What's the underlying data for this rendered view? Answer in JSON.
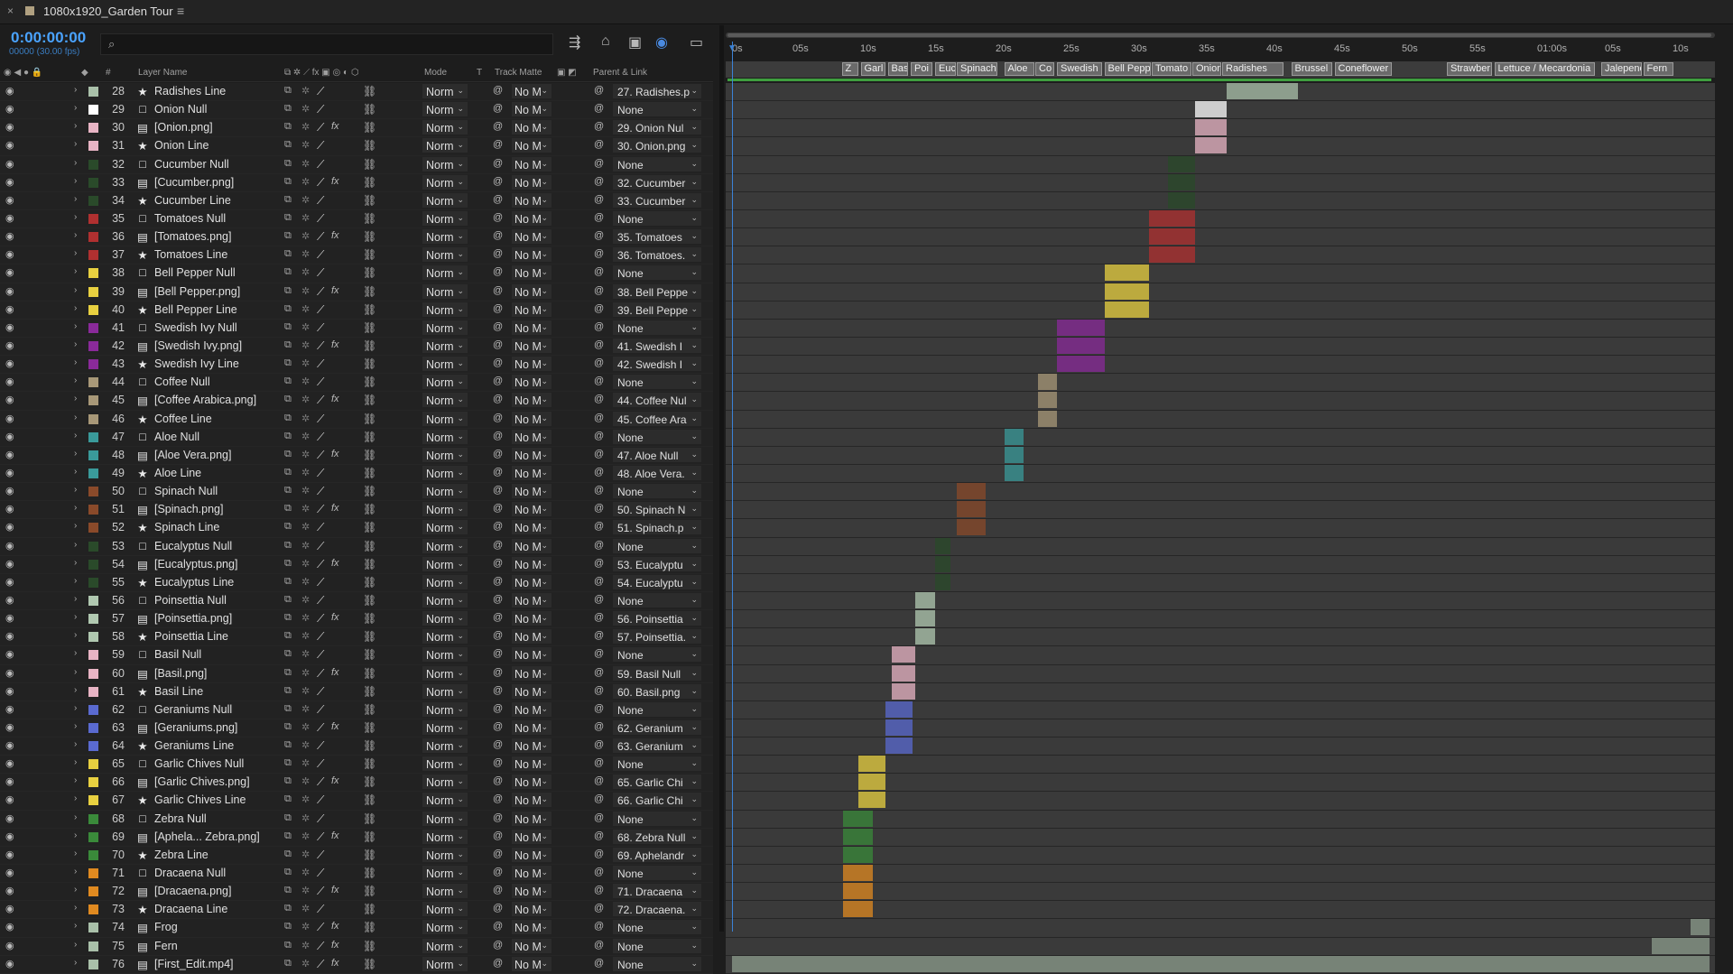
{
  "tab": {
    "close": "×",
    "title": "1080x1920_Garden Tour",
    "menu": "≡"
  },
  "timecode": "0:00:00:00",
  "fps": "00000 (30.00 fps)",
  "search": {
    "placeholder": ""
  },
  "headers": {
    "name": "Layer Name",
    "hash": "#",
    "mode": "Mode",
    "t": "T",
    "matte": "Track Matte",
    "parent": "Parent & Link"
  },
  "ruler_ticks": [
    "0s",
    "05s",
    "10s",
    "15s",
    "20s",
    "25s",
    "30s",
    "35s",
    "40s",
    "45s",
    "50s",
    "55s",
    "01:00s",
    "05s",
    "10s"
  ],
  "markers": [
    "Z",
    "Garl",
    "Basi",
    "Poi",
    "Euc",
    "Spinach",
    "Aloe",
    "Co",
    "Swedish",
    "Bell Pepp",
    "Tomato",
    "Onion",
    "Radishes",
    "Brussel",
    "Coneflower",
    "Strawber",
    "Lettuce / Mecardonia",
    "Jalepeno",
    "Fern"
  ],
  "layers": [
    {
      "num": "28",
      "name": "Radishes Line",
      "src": "★",
      "color": "#a9c0a9",
      "mode": "Norm",
      "matte": "No M",
      "parent": "27. Radishes.p",
      "start": 36.5,
      "end": 41.8
    },
    {
      "num": "29",
      "name": "Onion Null",
      "src": "□",
      "color": "#ffffff",
      "mode": "Norm",
      "matte": "No M",
      "parent": "None",
      "start": 34.2,
      "end": 36.5
    },
    {
      "num": "30",
      "name": "[Onion.png]",
      "src": "▤",
      "color": "#e8b4c4",
      "mode": "Norm",
      "matte": "No M",
      "parent": "29. Onion Nul",
      "start": 34.2,
      "end": 36.5
    },
    {
      "num": "31",
      "name": "Onion Line",
      "src": "★",
      "color": "#e8b4c4",
      "mode": "Norm",
      "matte": "No M",
      "parent": "30. Onion.png",
      "start": 34.2,
      "end": 36.5
    },
    {
      "num": "32",
      "name": "Cucumber Null",
      "src": "□",
      "color": "#2a4a2a",
      "mode": "Norm",
      "matte": "No M",
      "parent": "None",
      "start": 32.2,
      "end": 34.2
    },
    {
      "num": "33",
      "name": "[Cucumber.png]",
      "src": "▤",
      "color": "#2a4a2a",
      "mode": "Norm",
      "matte": "No M",
      "parent": "32. Cucumber",
      "start": 32.2,
      "end": 34.2
    },
    {
      "num": "34",
      "name": "Cucumber Line",
      "src": "★",
      "color": "#2a4a2a",
      "mode": "Norm",
      "matte": "No M",
      "parent": "33. Cucumber",
      "start": 32.2,
      "end": 34.2
    },
    {
      "num": "35",
      "name": "Tomatoes Null",
      "src": "□",
      "color": "#b03030",
      "mode": "Norm",
      "matte": "No M",
      "parent": "None",
      "start": 30.8,
      "end": 34.2
    },
    {
      "num": "36",
      "name": "[Tomatoes.png]",
      "src": "▤",
      "color": "#b03030",
      "mode": "Norm",
      "matte": "No M",
      "parent": "35. Tomatoes",
      "start": 30.8,
      "end": 34.2
    },
    {
      "num": "37",
      "name": "Tomatoes Line",
      "src": "★",
      "color": "#b03030",
      "mode": "Norm",
      "matte": "No M",
      "parent": "36. Tomatoes.",
      "start": 30.8,
      "end": 34.2
    },
    {
      "num": "38",
      "name": "Bell Pepper Null",
      "src": "□",
      "color": "#e8d040",
      "mode": "Norm",
      "matte": "No M",
      "parent": "None",
      "start": 27.5,
      "end": 30.8
    },
    {
      "num": "39",
      "name": "[Bell Pepper.png]",
      "src": "▤",
      "color": "#e8d040",
      "mode": "Norm",
      "matte": "No M",
      "parent": "38. Bell Peppe",
      "start": 27.5,
      "end": 30.8
    },
    {
      "num": "40",
      "name": "Bell Pepper Line",
      "src": "★",
      "color": "#e8d040",
      "mode": "Norm",
      "matte": "No M",
      "parent": "39. Bell Peppe",
      "start": 27.5,
      "end": 30.8
    },
    {
      "num": "41",
      "name": "Swedish Ivy Null",
      "src": "□",
      "color": "#8a2a9a",
      "mode": "Norm",
      "matte": "No M",
      "parent": "None",
      "start": 24.0,
      "end": 27.5
    },
    {
      "num": "42",
      "name": "[Swedish Ivy.png]",
      "src": "▤",
      "color": "#8a2a9a",
      "mode": "Norm",
      "matte": "No M",
      "parent": "41. Swedish I",
      "start": 24.0,
      "end": 27.5
    },
    {
      "num": "43",
      "name": "Swedish Ivy Line",
      "src": "★",
      "color": "#8a2a9a",
      "mode": "Norm",
      "matte": "No M",
      "parent": "42. Swedish I",
      "start": 24.0,
      "end": 27.5
    },
    {
      "num": "44",
      "name": "Coffee Null",
      "src": "□",
      "color": "#a89878",
      "mode": "Norm",
      "matte": "No M",
      "parent": "None",
      "start": 22.6,
      "end": 24.0
    },
    {
      "num": "45",
      "name": "[Coffee Arabica.png]",
      "src": "▤",
      "color": "#a89878",
      "mode": "Norm",
      "matte": "No M",
      "parent": "44. Coffee Nul",
      "start": 22.6,
      "end": 24.0
    },
    {
      "num": "46",
      "name": "Coffee Line",
      "src": "★",
      "color": "#a89878",
      "mode": "Norm",
      "matte": "No M",
      "parent": "45. Coffee Ara",
      "start": 22.6,
      "end": 24.0
    },
    {
      "num": "47",
      "name": "Aloe Null",
      "src": "□",
      "color": "#3a9a9a",
      "mode": "Norm",
      "matte": "No M",
      "parent": "None",
      "start": 20.1,
      "end": 21.5
    },
    {
      "num": "48",
      "name": "[Aloe Vera.png]",
      "src": "▤",
      "color": "#3a9a9a",
      "mode": "Norm",
      "matte": "No M",
      "parent": "47. Aloe Null",
      "start": 20.1,
      "end": 21.5
    },
    {
      "num": "49",
      "name": "Aloe Line",
      "src": "★",
      "color": "#3a9a9a",
      "mode": "Norm",
      "matte": "No M",
      "parent": "48. Aloe Vera.",
      "start": 20.1,
      "end": 21.5
    },
    {
      "num": "50",
      "name": "Spinach Null",
      "src": "□",
      "color": "#8a4a2a",
      "mode": "Norm",
      "matte": "No M",
      "parent": "None",
      "start": 16.6,
      "end": 18.7
    },
    {
      "num": "51",
      "name": "[Spinach.png]",
      "src": "▤",
      "color": "#8a4a2a",
      "mode": "Norm",
      "matte": "No M",
      "parent": "50. Spinach N",
      "start": 16.6,
      "end": 18.7
    },
    {
      "num": "52",
      "name": "Spinach Line",
      "src": "★",
      "color": "#8a4a2a",
      "mode": "Norm",
      "matte": "No M",
      "parent": "51. Spinach.p",
      "start": 16.6,
      "end": 18.7
    },
    {
      "num": "53",
      "name": "Eucalyptus Null",
      "src": "□",
      "color": "#2a4a2a",
      "mode": "Norm",
      "matte": "No M",
      "parent": "None",
      "start": 15.0,
      "end": 16.1
    },
    {
      "num": "54",
      "name": "[Eucalyptus.png]",
      "src": "▤",
      "color": "#2a4a2a",
      "mode": "Norm",
      "matte": "No M",
      "parent": "53. Eucalyptu",
      "start": 15.0,
      "end": 16.1
    },
    {
      "num": "55",
      "name": "Eucalyptus Line",
      "src": "★",
      "color": "#2a4a2a",
      "mode": "Norm",
      "matte": "No M",
      "parent": "54. Eucalyptu",
      "start": 15.0,
      "end": 16.1
    },
    {
      "num": "56",
      "name": "Poinsettia Null",
      "src": "□",
      "color": "#b0c8b0",
      "mode": "Norm",
      "matte": "No M",
      "parent": "None",
      "start": 13.5,
      "end": 15.0
    },
    {
      "num": "57",
      "name": "[Poinsettia.png]",
      "src": "▤",
      "color": "#b0c8b0",
      "mode": "Norm",
      "matte": "No M",
      "parent": "56. Poinsettia",
      "start": 13.5,
      "end": 15.0
    },
    {
      "num": "58",
      "name": "Poinsettia Line",
      "src": "★",
      "color": "#b0c8b0",
      "mode": "Norm",
      "matte": "No M",
      "parent": "57. Poinsettia.",
      "start": 13.5,
      "end": 15.0
    },
    {
      "num": "59",
      "name": "Basil Null",
      "src": "□",
      "color": "#e8b4c4",
      "mode": "Norm",
      "matte": "No M",
      "parent": "None",
      "start": 11.8,
      "end": 13.5
    },
    {
      "num": "60",
      "name": "[Basil.png]",
      "src": "▤",
      "color": "#e8b4c4",
      "mode": "Norm",
      "matte": "No M",
      "parent": "59. Basil Null",
      "start": 11.8,
      "end": 13.5
    },
    {
      "num": "61",
      "name": "Basil Line",
      "src": "★",
      "color": "#e8b4c4",
      "mode": "Norm",
      "matte": "No M",
      "parent": "60. Basil.png",
      "start": 11.8,
      "end": 13.5
    },
    {
      "num": "62",
      "name": "Geraniums Null",
      "src": "□",
      "color": "#5a6ad0",
      "mode": "Norm",
      "matte": "No M",
      "parent": "None",
      "start": 11.3,
      "end": 13.3
    },
    {
      "num": "63",
      "name": "[Geraniums.png]",
      "src": "▤",
      "color": "#5a6ad0",
      "mode": "Norm",
      "matte": "No M",
      "parent": "62. Geranium",
      "start": 11.3,
      "end": 13.3
    },
    {
      "num": "64",
      "name": "Geraniums Line",
      "src": "★",
      "color": "#5a6ad0",
      "mode": "Norm",
      "matte": "No M",
      "parent": "63. Geranium",
      "start": 11.3,
      "end": 13.3
    },
    {
      "num": "65",
      "name": "Garlic Chives Null",
      "src": "□",
      "color": "#e8d040",
      "mode": "Norm",
      "matte": "No M",
      "parent": "None",
      "start": 9.3,
      "end": 11.3
    },
    {
      "num": "66",
      "name": "[Garlic Chives.png]",
      "src": "▤",
      "color": "#e8d040",
      "mode": "Norm",
      "matte": "No M",
      "parent": "65. Garlic Chi",
      "start": 9.3,
      "end": 11.3
    },
    {
      "num": "67",
      "name": "Garlic Chives Line",
      "src": "★",
      "color": "#e8d040",
      "mode": "Norm",
      "matte": "No M",
      "parent": "66. Garlic Chi",
      "start": 9.3,
      "end": 11.3
    },
    {
      "num": "68",
      "name": "Zebra Null",
      "src": "□",
      "color": "#3a8a3a",
      "mode": "Norm",
      "matte": "No M",
      "parent": "None",
      "start": 8.2,
      "end": 10.4
    },
    {
      "num": "69",
      "name": "[Aphela... Zebra.png]",
      "src": "▤",
      "color": "#3a8a3a",
      "mode": "Norm",
      "matte": "No M",
      "parent": "68. Zebra Null",
      "start": 8.2,
      "end": 10.4
    },
    {
      "num": "70",
      "name": "Zebra Line",
      "src": "★",
      "color": "#3a8a3a",
      "mode": "Norm",
      "matte": "No M",
      "parent": "69. Aphelandr",
      "start": 8.2,
      "end": 10.4
    },
    {
      "num": "71",
      "name": "Dracaena Null",
      "src": "□",
      "color": "#e08a20",
      "mode": "Norm",
      "matte": "No M",
      "parent": "None",
      "start": 8.2,
      "end": 10.4
    },
    {
      "num": "72",
      "name": "[Dracaena.png]",
      "src": "▤",
      "color": "#e08a20",
      "mode": "Norm",
      "matte": "No M",
      "parent": "71. Dracaena",
      "start": 8.2,
      "end": 10.4
    },
    {
      "num": "73",
      "name": "Dracaena Line",
      "src": "★",
      "color": "#e08a20",
      "mode": "Norm",
      "matte": "No M",
      "parent": "72. Dracaena.",
      "start": 8.2,
      "end": 10.4
    },
    {
      "num": "74",
      "name": "Frog",
      "src": "▤",
      "color": "#a9c0a9",
      "mode": "Norm",
      "matte": "No M",
      "parent": "None",
      "start": 70.8,
      "end": 72.8
    },
    {
      "num": "75",
      "name": "Fern",
      "src": "▤",
      "color": "#a9c0a9",
      "mode": "Norm",
      "matte": "No M",
      "parent": "None",
      "start": 67.9,
      "end": 72.2
    },
    {
      "num": "76",
      "name": "[First_Edit.mp4]",
      "src": "▤",
      "color": "#a9c0a9",
      "mode": "Norm",
      "matte": "No M",
      "parent": "None",
      "start": 0,
      "end": 72.8
    }
  ]
}
